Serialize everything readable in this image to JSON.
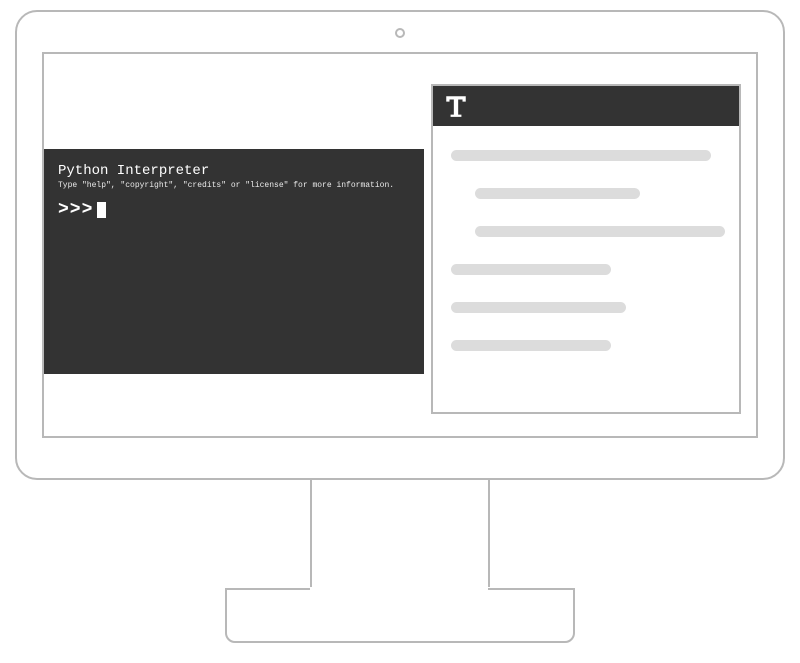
{
  "terminal": {
    "title": "Python Interpreter",
    "subtitle": "Type \"help\", \"copyright\", \"credits\" or \"license\" for more information.",
    "prompt": ">>>"
  },
  "doc": {
    "icon_label": "T"
  }
}
